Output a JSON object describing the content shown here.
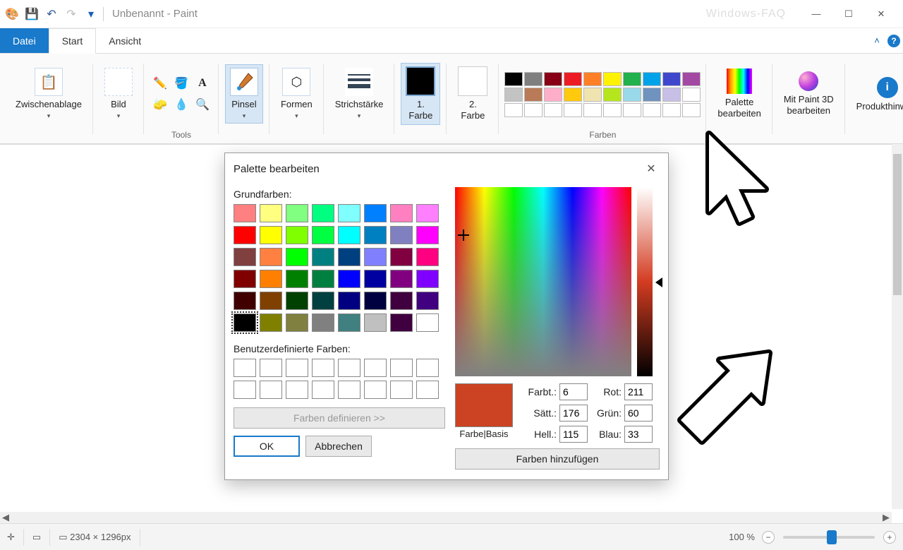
{
  "title": "Unbenannt - Paint",
  "watermark": "Windows-FAQ",
  "tabs": {
    "file": "Datei",
    "start": "Start",
    "view": "Ansicht"
  },
  "ribbon": {
    "clipboard": {
      "label": "Zwischenablage"
    },
    "image": {
      "label": "Bild"
    },
    "tools_label": "Tools",
    "brush": {
      "label": "Pinsel"
    },
    "shapes": {
      "label": "Formen"
    },
    "stroke": {
      "label": "Strichstärke"
    },
    "color1": {
      "label": "1.\nFarbe"
    },
    "color2": {
      "label": "2.\nFarbe"
    },
    "colors_label": "Farben",
    "edit_palette": "Palette\nbearbeiten",
    "paint3d": "Mit Paint 3D\nbearbeiten",
    "hint": "Produkthinweis",
    "palette_row1": [
      "#000000",
      "#7f7f7f",
      "#880015",
      "#ed1c24",
      "#ff7f27",
      "#fff200",
      "#22b14c",
      "#00a2e8",
      "#3f48cc",
      "#a349a4"
    ],
    "palette_row2": [
      "#c3c3c3",
      "#b97a57",
      "#ffaec9",
      "#ffc90e",
      "#efe4b0",
      "#b5e61d",
      "#99d9ea",
      "#7092be",
      "#c8bfe7",
      "#ffffff"
    ],
    "palette_row3": [
      "#ffffff",
      "#ffffff",
      "#ffffff",
      "#ffffff",
      "#ffffff",
      "#ffffff",
      "#ffffff",
      "#ffffff",
      "#ffffff",
      "#ffffff"
    ]
  },
  "dialog": {
    "title": "Palette bearbeiten",
    "basic_label": "Grundfarben:",
    "custom_label": "Benutzerdefinierte Farben:",
    "define": "Farben definieren >>",
    "ok": "OK",
    "cancel": "Abbrechen",
    "preview_label": "Farbe|Basis",
    "add": "Farben hinzufügen",
    "fields": {
      "hue_l": "Farbt.:",
      "hue": "6",
      "sat_l": "Sätt.:",
      "sat": "176",
      "lum_l": "Hell.:",
      "lum": "115",
      "r_l": "Rot:",
      "r": "211",
      "g_l": "Grün:",
      "g": "60",
      "b_l": "Blau:",
      "b": "33"
    },
    "basic_colors": [
      "#ff8080",
      "#ffff80",
      "#80ff80",
      "#00ff80",
      "#80ffff",
      "#0080ff",
      "#ff80c0",
      "#ff80ff",
      "#ff0000",
      "#ffff00",
      "#80ff00",
      "#00ff40",
      "#00ffff",
      "#0080c0",
      "#8080c0",
      "#ff00ff",
      "#804040",
      "#ff8040",
      "#00ff00",
      "#008080",
      "#004080",
      "#8080ff",
      "#800040",
      "#ff0080",
      "#800000",
      "#ff8000",
      "#008000",
      "#008040",
      "#0000ff",
      "#0000a0",
      "#800080",
      "#8000ff",
      "#400000",
      "#804000",
      "#004000",
      "#004040",
      "#000080",
      "#000040",
      "#400040",
      "#400080",
      "#000000",
      "#808000",
      "#808040",
      "#808080",
      "#408080",
      "#c0c0c0",
      "#400040",
      "#ffffff"
    ]
  },
  "status": {
    "dims": "2304 × 1296px",
    "zoom": "100 %"
  }
}
